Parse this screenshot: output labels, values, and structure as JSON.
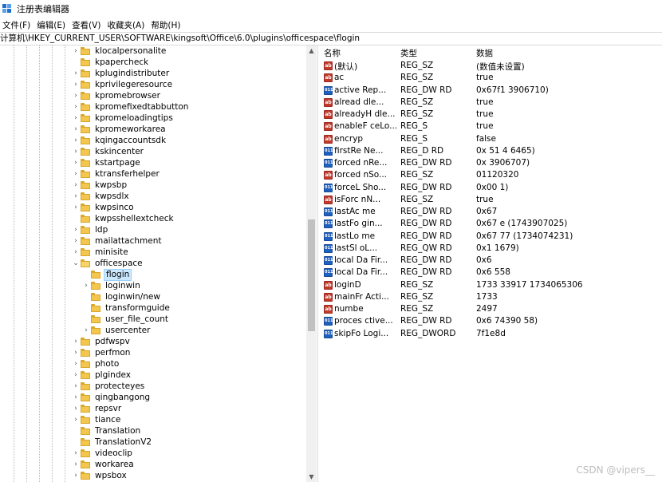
{
  "window": {
    "title": "注册表编辑器",
    "app_icon": "registry-editor-icon"
  },
  "menu": [
    "文件(F)",
    "编辑(E)",
    "查看(V)",
    "收藏夹(A)",
    "帮助(H)"
  ],
  "address": "计算机\\HKEY_CURRENT_USER\\SOFTWARE\\kingsoft\\Office\\6.0\\plugins\\officespace\\flogin",
  "tree": [
    {
      "label": "klocalpersonalite",
      "chevron": ">"
    },
    {
      "label": "kpapercheck",
      "chevron": ""
    },
    {
      "label": "kplugindistributer",
      "chevron": ">"
    },
    {
      "label": "kprivilegeresource",
      "chevron": ">"
    },
    {
      "label": "kpromebrowser",
      "chevron": ">"
    },
    {
      "label": "kpromefixedtabbutton",
      "chevron": ">"
    },
    {
      "label": "kpromeloadingtips",
      "chevron": ">"
    },
    {
      "label": "kpromeworkarea",
      "chevron": ">"
    },
    {
      "label": "kqingaccountsdk",
      "chevron": ">"
    },
    {
      "label": "kskincenter",
      "chevron": ">"
    },
    {
      "label": "kstartpage",
      "chevron": ">"
    },
    {
      "label": "ktransferhelper",
      "chevron": ">"
    },
    {
      "label": "kwpsbp",
      "chevron": ">"
    },
    {
      "label": "kwpsdlx",
      "chevron": ">"
    },
    {
      "label": "kwpsinco",
      "chevron": ">"
    },
    {
      "label": "kwpsshellextcheck",
      "chevron": ""
    },
    {
      "label": "ldp",
      "chevron": ">"
    },
    {
      "label": "mailattachment",
      "chevron": ">"
    },
    {
      "label": "minisite",
      "chevron": ">"
    },
    {
      "label": "officespace",
      "chevron": "v",
      "open": true
    },
    {
      "label": "flogin",
      "chevron": "",
      "child": true,
      "selected": true
    },
    {
      "label": "loginwin",
      "chevron": ">",
      "child": true
    },
    {
      "label": "loginwin/new",
      "chevron": "",
      "child": true
    },
    {
      "label": "transformguide",
      "chevron": "",
      "child": true
    },
    {
      "label": "user_file_count",
      "chevron": "",
      "child": true
    },
    {
      "label": "usercenter",
      "chevron": ">",
      "child": true
    },
    {
      "label": "pdfwspv",
      "chevron": ">"
    },
    {
      "label": "perfmon",
      "chevron": ">"
    },
    {
      "label": "photo",
      "chevron": ">"
    },
    {
      "label": "plgindex",
      "chevron": ">"
    },
    {
      "label": "protecteyes",
      "chevron": ">"
    },
    {
      "label": "qingbangong",
      "chevron": ">"
    },
    {
      "label": "repsvr",
      "chevron": ">"
    },
    {
      "label": "tiance",
      "chevron": ">"
    },
    {
      "label": "Translation",
      "chevron": ""
    },
    {
      "label": "TranslationV2",
      "chevron": ""
    },
    {
      "label": "videoclip",
      "chevron": ">"
    },
    {
      "label": "workarea",
      "chevron": ">"
    },
    {
      "label": "wpsbox",
      "chevron": ">"
    }
  ],
  "columns": {
    "name": "名称",
    "type": "类型",
    "data": "数据"
  },
  "values": [
    {
      "icon": "string-value-icon",
      "kind": "sz",
      "name": "(默认)",
      "type": "REG_SZ",
      "data": "(数值未设置)"
    },
    {
      "icon": "string-value-icon",
      "kind": "sz",
      "name": "ac",
      "type": "REG_SZ",
      "data": "true"
    },
    {
      "icon": "binary-value-icon",
      "kind": "bin",
      "name": "active Rep...",
      "type": "REG_DW RD",
      "data": "0x67f1 3906710)"
    },
    {
      "icon": "string-value-icon",
      "kind": "sz",
      "name": "alread dle...",
      "type": "REG_SZ",
      "data": "true"
    },
    {
      "icon": "string-value-icon",
      "kind": "sz",
      "name": "alreadyH dle...",
      "type": "REG_SZ",
      "data": "true"
    },
    {
      "icon": "string-value-icon",
      "kind": "sz",
      "name": "enableF ceLo...",
      "type": "REG_S",
      "data": "true"
    },
    {
      "icon": "string-value-icon",
      "kind": "sz",
      "name": "encryp",
      "type": "REG_S",
      "data": "false"
    },
    {
      "icon": "binary-value-icon",
      "kind": "bin",
      "name": "firstRe Ne...",
      "type": "REG_D RD",
      "data": "0x 51 4 6465)"
    },
    {
      "icon": "binary-value-icon",
      "kind": "bin",
      "name": "forced nRe...",
      "type": "REG_DW RD",
      "data": "0x 3906707)"
    },
    {
      "icon": "string-value-icon",
      "kind": "sz",
      "name": "forced nSo...",
      "type": "REG_SZ",
      "data": "01120320"
    },
    {
      "icon": "binary-value-icon",
      "kind": "bin",
      "name": "forceL Sho...",
      "type": "REG_DW RD",
      "data": "0x00 1)"
    },
    {
      "icon": "string-value-icon",
      "kind": "sz",
      "name": "isForc nN...",
      "type": "REG_SZ",
      "data": "true"
    },
    {
      "icon": "binary-value-icon",
      "kind": "bin",
      "name": "lastAc me",
      "type": "REG_DW RD",
      "data": "0x67"
    },
    {
      "icon": "binary-value-icon",
      "kind": "bin",
      "name": "lastFo gin...",
      "type": "REG_DW RD",
      "data": "0x67 e (1743907025)"
    },
    {
      "icon": "binary-value-icon",
      "kind": "bin",
      "name": "lastLo me",
      "type": "REG_DW RD",
      "data": "0x67 77 (1734074231)"
    },
    {
      "icon": "binary-value-icon",
      "kind": "bin",
      "name": "lastSl oL...",
      "type": "REG_QW RD",
      "data": "0x1 1679)"
    },
    {
      "icon": "binary-value-icon",
      "kind": "bin",
      "name": "local Da Fir...",
      "type": "REG_DW RD",
      "data": "0x6"
    },
    {
      "icon": "binary-value-icon",
      "kind": "bin",
      "name": "local Da Fir...",
      "type": "REG_DW RD",
      "data": "0x6 558"
    },
    {
      "icon": "string-value-icon",
      "kind": "sz",
      "name": "loginD",
      "type": "REG_SZ",
      "data": "1733 33917 1734065306"
    },
    {
      "icon": "string-value-icon",
      "kind": "sz",
      "name": "mainFr Acti...",
      "type": "REG_SZ",
      "data": "1733"
    },
    {
      "icon": "string-value-icon",
      "kind": "sz",
      "name": "numbe",
      "type": "REG_SZ",
      "data": "2497"
    },
    {
      "icon": "binary-value-icon",
      "kind": "bin",
      "name": "proces ctive...",
      "type": "REG_DW RD",
      "data": "0x6 74390 58)"
    },
    {
      "icon": "binary-value-icon",
      "kind": "bin",
      "name": "skipFo Logi...",
      "type": "REG_DWORD",
      "data": "7f1e8d"
    }
  ],
  "watermark": "CSDN @vipers__"
}
